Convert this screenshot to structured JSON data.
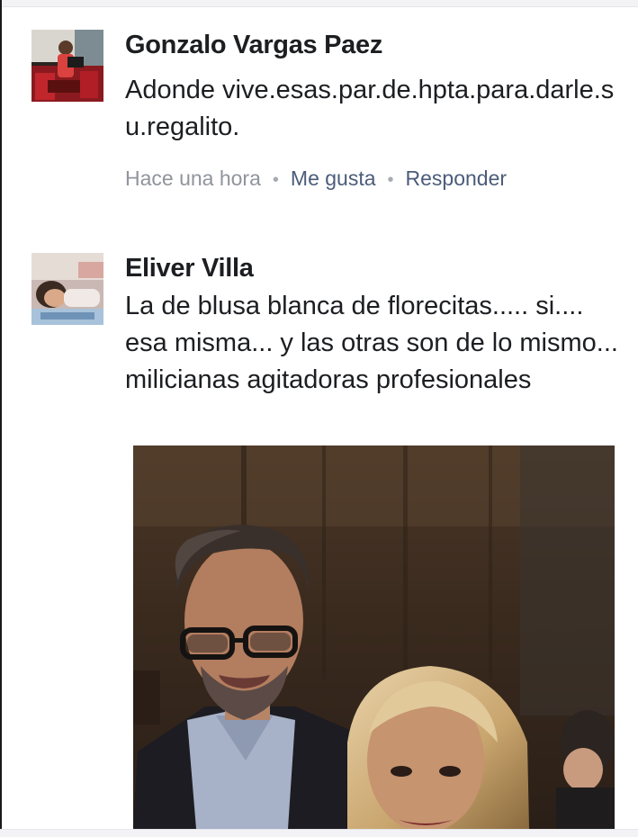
{
  "comments": [
    {
      "author": "Gonzalo Vargas Paez",
      "text": "Adonde vive.esas.par.de.hpta.para.darle.su.regalito.",
      "time": "Hace una hora",
      "like_label": "Me gusta",
      "reply_label": "Responder"
    },
    {
      "author": "Eliver Villa",
      "text": "La de blusa blanca de florecitas..... si.... esa misma... y las otras son de lo mismo... milicianas agitadoras profesionales"
    }
  ],
  "icons": {
    "avatar_1": "user-avatar-photo",
    "avatar_2": "user-avatar-photo",
    "separator": "middle-dot"
  }
}
